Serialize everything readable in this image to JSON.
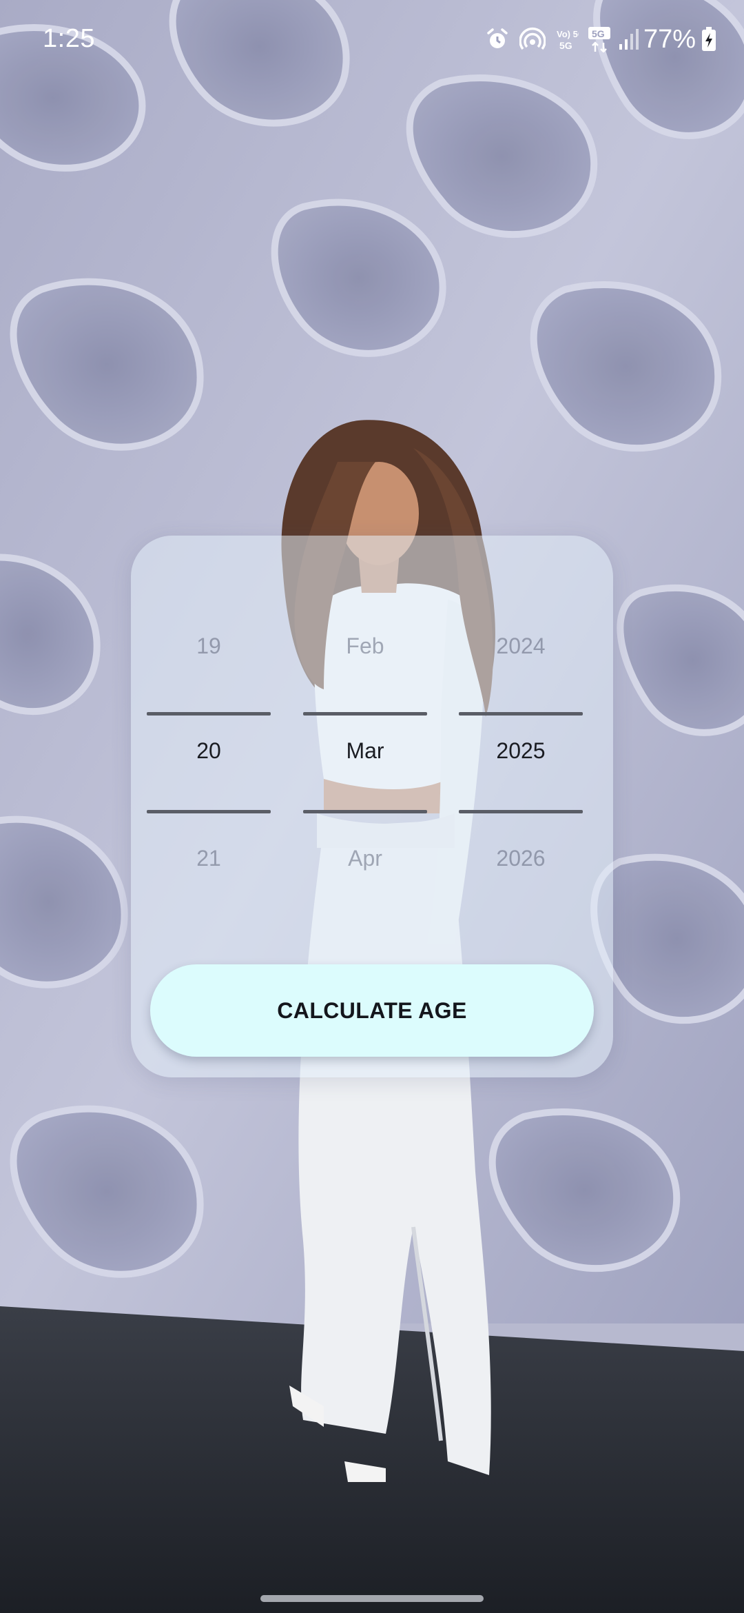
{
  "status_bar": {
    "time": "1:25",
    "battery_percent": "77%",
    "icons": [
      "alarm-icon",
      "hotspot-icon",
      "volte-icon",
      "5g-data-icon",
      "signal-icon",
      "battery-charging-icon"
    ],
    "volte_label": "Vo) 5G",
    "network_label": "5G"
  },
  "date_picker": {
    "day": {
      "previous": "19",
      "selected": "20",
      "next": "21"
    },
    "month": {
      "previous": "Feb",
      "selected": "Mar",
      "next": "Apr"
    },
    "year": {
      "previous": "2024",
      "selected": "2025",
      "next": "2026"
    }
  },
  "actions": {
    "calculate_label": "CALCULATE AGE"
  },
  "colors": {
    "button_bg": "#dcfcfd",
    "card_bg": "#e1ecf7",
    "wall": "#b7b9cf",
    "floor": "#2b2f36"
  }
}
